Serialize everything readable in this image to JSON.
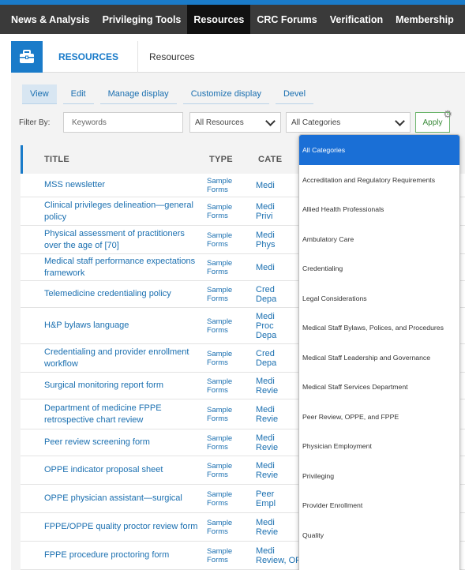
{
  "topnav": {
    "items": [
      {
        "label": "News & Analysis",
        "active": false
      },
      {
        "label": "Privileging Tools",
        "active": false
      },
      {
        "label": "Resources",
        "active": true
      },
      {
        "label": "CRC Forums",
        "active": false
      },
      {
        "label": "Verification",
        "active": false
      },
      {
        "label": "Membership",
        "active": false
      }
    ]
  },
  "resource_header": {
    "icon": "briefcase-icon",
    "active_tab": "RESOURCES",
    "crumb": "Resources"
  },
  "view_tabs": [
    "View",
    "Edit",
    "Manage display",
    "Customize display",
    "Devel"
  ],
  "filters": {
    "label": "Filter By:",
    "keywords_placeholder": "Keywords",
    "resources_selected": "All Resources",
    "categories_selected": "All Categories",
    "apply_label": "Apply"
  },
  "table": {
    "headers": {
      "title": "TITLE",
      "type": "TYPE",
      "category": "CATE"
    },
    "rows": [
      {
        "title": "MSS newsletter",
        "type": "Sample\nForms",
        "category": "Medi"
      },
      {
        "title": "Clinical privileges delineation—general policy",
        "type": "Sample\nForms",
        "category": "Medi\nPrivi"
      },
      {
        "title": "Physical assessment of practitioners over the age of [70]",
        "type": "Sample\nForms",
        "category": "Medi\nPhys"
      },
      {
        "title": "Medical staff performance expectations framework",
        "type": "Sample\nForms",
        "category": "Medi"
      },
      {
        "title": "Telemedicine credentialing policy",
        "type": "Sample\nForms",
        "category": "Cred\nDepa"
      },
      {
        "title": "H&P bylaws language",
        "type": "Sample\nForms",
        "category": "Medi\nProc\nDepa"
      },
      {
        "title": "Credentialing and provider enrollment workflow",
        "type": "Sample\nForms",
        "category": "Cred\nDepa"
      },
      {
        "title": "Surgical monitoring report form",
        "type": "Sample\nForms",
        "category": "Medi\nRevie"
      },
      {
        "title": "Department of medicine FPPE retrospective chart review",
        "type": "Sample\nForms",
        "category": "Medi\nRevie"
      },
      {
        "title": "Peer review screening form",
        "type": "Sample\nForms",
        "category": "Medi\nRevie"
      },
      {
        "title": "OPPE indicator proposal sheet",
        "type": "Sample\nForms",
        "category": "Medi\nRevie"
      },
      {
        "title": "OPPE physician assistant—surgical",
        "type": "Sample\nForms",
        "category": "Peer\nEmpl"
      },
      {
        "title": "FPPE/OPPE quality proctor review form",
        "type": "Sample\nForms",
        "category": "Medi\nRevie"
      },
      {
        "title": "FPPE procedure proctoring form",
        "type": "Sample\nForms",
        "category": "Medi\nReview, OPPE, and FPPE"
      }
    ]
  },
  "category_dropdown": {
    "selected_index": 0,
    "options": [
      "All Categories",
      "Accreditation and Regulatory Requirements",
      "Allied Health Professionals",
      "Ambulatory Care",
      "Credentialing",
      "Legal Considerations",
      "Medical Staff Bylaws, Polices, and Procedures",
      "Medical Staff Leadership and Governance",
      "Medical Staff Services Department",
      "Peer Review, OPPE, and FPPE",
      "Physician Employment",
      "Privileging",
      "Provider Enrollment",
      "Quality"
    ]
  }
}
